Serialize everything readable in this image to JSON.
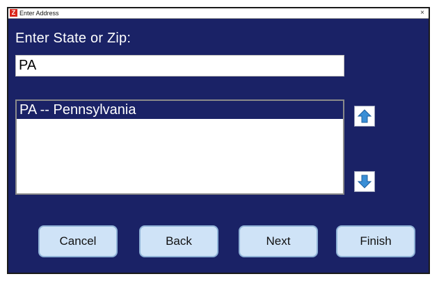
{
  "window": {
    "title": "Enter Address",
    "close_glyph": "×",
    "app_icon_glyph": "Z"
  },
  "prompt": {
    "label": "Enter State or Zip:"
  },
  "search": {
    "value": "PA"
  },
  "results": {
    "items": [
      {
        "label": "PA -- Pennsylvania",
        "selected": true
      }
    ]
  },
  "scroll": {
    "up_icon": "arrow-up-icon",
    "down_icon": "arrow-down-icon"
  },
  "buttons": {
    "cancel": "Cancel",
    "back": "Back",
    "next": "Next",
    "finish": "Finish"
  },
  "colors": {
    "background": "#1a2266",
    "selection": "#1a2266",
    "button_fill": "#cfe3f7",
    "arrow_fill": "#3a8fd6"
  }
}
